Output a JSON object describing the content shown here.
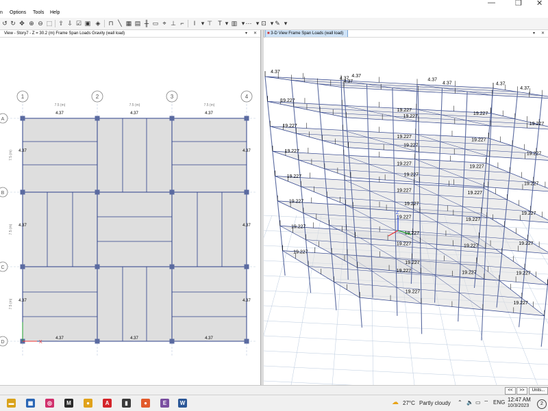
{
  "window": {
    "minimize_glyph": "—",
    "restore_glyph": "❐",
    "close_glyph": "✕"
  },
  "menu": {
    "items": [
      "n",
      "Options",
      "Tools",
      "Help"
    ]
  },
  "left_pane": {
    "title": "View - Story7 - Z = 30.2 (m)  Frame Span Loads Gravity (wall load)",
    "grid_x": [
      "1",
      "2",
      "3",
      "4"
    ],
    "grid_y": [
      "A",
      "B",
      "C",
      "D"
    ],
    "span_x_label": "7.5 (m)",
    "span_y_label": "7.5 (m)",
    "load_label": "4.37",
    "axis_x_label": "X"
  },
  "right_pane": {
    "title": "3-D View  Frame Span Loads (wall load)",
    "roof_load": "4.37",
    "floor_load": "19.227",
    "axis_z_label": "Z"
  },
  "status_bar": {
    "prev_label": "<<",
    "next_label": ">>",
    "units_label": "Units..."
  },
  "taskbar": {
    "apps": [
      {
        "icon": "file-explorer-icon",
        "color": "#d9a21b",
        "glyph": "▬"
      },
      {
        "icon": "store-icon",
        "color": "#2a66b5",
        "glyph": "▦"
      },
      {
        "icon": "instagram-icon",
        "color": "#d1306c",
        "glyph": "◎"
      },
      {
        "icon": "media-icon",
        "color": "#2b2b2b",
        "glyph": "M"
      },
      {
        "icon": "chrome-icon",
        "color": "#e0a21b",
        "glyph": "●"
      },
      {
        "icon": "pdf-icon",
        "color": "#d4242a",
        "glyph": "A"
      },
      {
        "icon": "app-icon",
        "color": "#3a3a3a",
        "glyph": "▮"
      },
      {
        "icon": "chrome-profile-icon",
        "color": "#e25b2c",
        "glyph": "●"
      },
      {
        "icon": "etabs-icon",
        "color": "#7a4fa0",
        "glyph": "E"
      },
      {
        "icon": "word-icon",
        "color": "#2b5797",
        "glyph": "W"
      }
    ],
    "weather": {
      "temp": "27°C",
      "desc": "Partly cloudy"
    },
    "clock": {
      "time": "12:47 AM",
      "date": "10/3/2023"
    },
    "lang": "ENG",
    "notification_count": "2"
  },
  "colors": {
    "slab": "#dedede",
    "beam": "#2b3f8a",
    "column": "#5a6aa0",
    "load_arrow": "#000000",
    "grid_line": "#b9c9de",
    "bubble": "#7f7f7f",
    "axis_red": "#e33",
    "axis_green": "#1a9c2b",
    "axis_blue": "#2747d8"
  }
}
